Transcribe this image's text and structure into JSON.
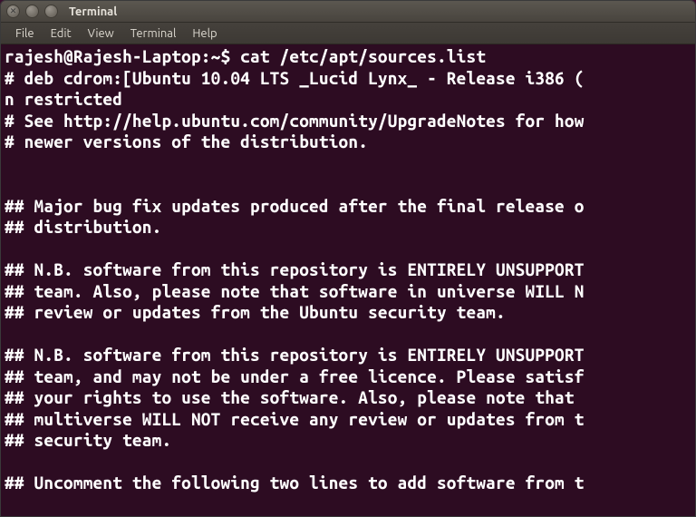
{
  "window": {
    "title": "Terminal"
  },
  "menubar": {
    "file": "File",
    "edit": "Edit",
    "view": "View",
    "terminal": "Terminal",
    "help": "Help"
  },
  "terminal": {
    "prompt": "rajesh@Rajesh-Laptop:~$ ",
    "command": "cat /etc/apt/sources.list",
    "lines": [
      "# deb cdrom:[Ubuntu 10.04 LTS _Lucid Lynx_ - Release i386 (",
      "n restricted",
      "# See http://help.ubuntu.com/community/UpgradeNotes for how",
      "# newer versions of the distribution.",
      "",
      "",
      "## Major bug fix updates produced after the final release o",
      "## distribution.",
      "",
      "## N.B. software from this repository is ENTIRELY UNSUPPORT",
      "## team. Also, please note that software in universe WILL N",
      "## review or updates from the Ubuntu security team.",
      "",
      "## N.B. software from this repository is ENTIRELY UNSUPPORT",
      "## team, and may not be under a free licence. Please satisf",
      "## your rights to use the software. Also, please note that ",
      "## multiverse WILL NOT receive any review or updates from t",
      "## security team.",
      "",
      "## Uncomment the following two lines to add software from t"
    ]
  }
}
